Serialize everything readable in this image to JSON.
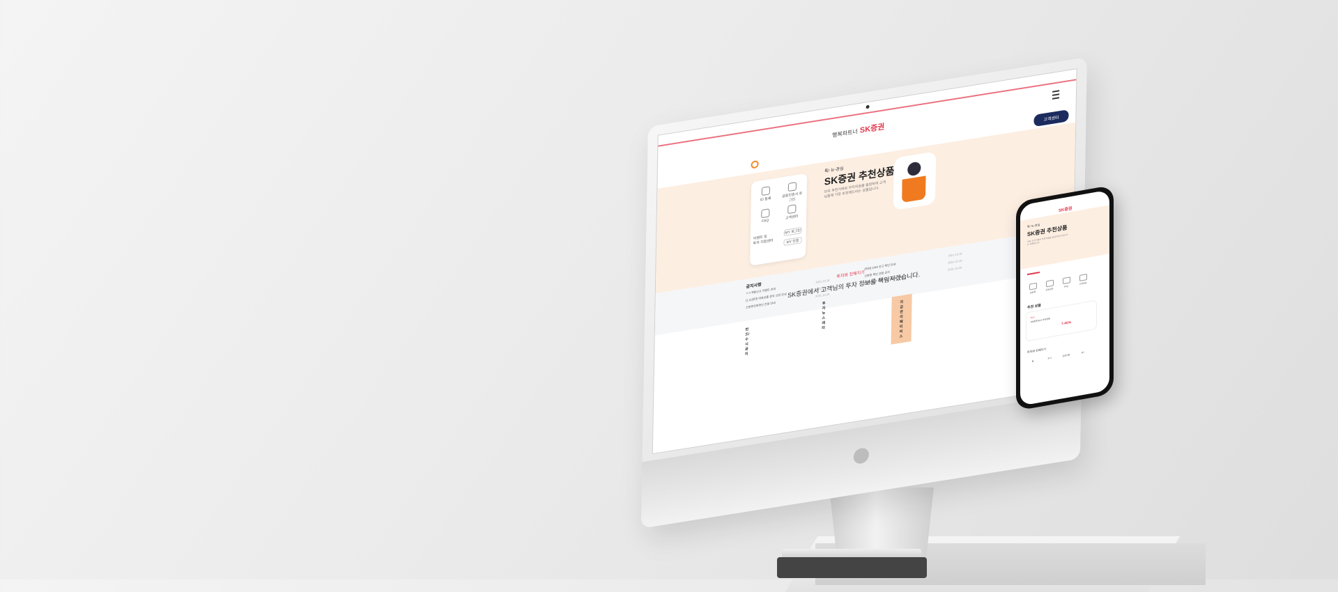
{
  "site": {
    "logo_prefix": "행복파트너",
    "logo_brand": "SK증권",
    "cs_button": "고객센터"
  },
  "hero": {
    "eyebrow": "톡! 뉴-관심",
    "title": "SK증권 추천상품",
    "desc": "보유 추천거래로 부자의꿈을 응원하며 고객님들께 가장 추천해드리는 상품입니다."
  },
  "quick_menu": [
    {
      "label": "ID 등록",
      "icon": "id-icon"
    },
    {
      "label": "공동인증서 로그인",
      "icon": "laptop-icon"
    },
    {
      "label": "FAQ",
      "icon": "faq-icon"
    },
    {
      "label": "고객센터",
      "icon": "headset-icon"
    }
  ],
  "quick_extra": {
    "label1": "이벤트 및",
    "label2": "투자 지원센터",
    "login": "MY 로그인",
    "cert": "MY 인증"
  },
  "notice": {
    "title": "공지사항",
    "items": [
      {
        "text": "ㅇㅇ개발신규 이벤트 안내",
        "date": "2021.10.18"
      },
      {
        "text": "[1.11]증권 대표상품 문의 신청 안내",
        "date": "2021.10.18"
      },
      {
        "text": "신분증진위확인 관련 안내",
        "date": "2021.10.20"
      }
    ],
    "right_items": [
      {
        "text": "[마감] CMA 잔고 확인 안내",
        "date": "2021.10.18"
      },
      {
        "text": "신분증 확인 관련 공지",
        "date": "2021.10.19"
      },
      {
        "text": "[단독] 신규 계좌 개설 이벤트 안내",
        "date": "2021.10.20"
      }
    ]
  },
  "section": {
    "tag": "투자와 친해지기",
    "title": "SK증권에서 고객님의 투자 정보를 책임지겠습니다."
  },
  "bottom": {
    "left_title": "펀드/수시공지",
    "right_title": "투자뉴스레터",
    "banner": "자금관리 페티버스"
  },
  "phone": {
    "logo": "SK증권",
    "eyebrow": "톡! 뉴-관심",
    "title": "SK증권 추천상품",
    "desc": "보유 추천거래로 부자의꿈을 응원하며 추천드리는 상품입니다.",
    "icons": [
      "ID등록",
      "공동인증",
      "FAQ",
      "고객센터"
    ],
    "section": "추천 상품",
    "card_tag": "ELS",
    "card_name": "SK증권 ELS 추천상품",
    "card_rate": "7.45%",
    "section2": "투자와 친해지기",
    "tabs": [
      "홈",
      "주식",
      "금융상품",
      "MY"
    ]
  }
}
